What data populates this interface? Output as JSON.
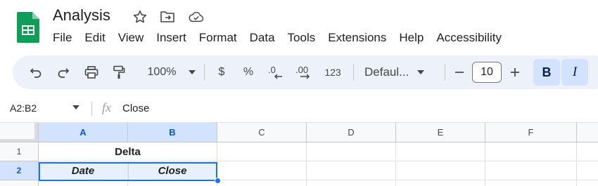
{
  "doc": {
    "title": "Analysis"
  },
  "menu": [
    "File",
    "Edit",
    "View",
    "Insert",
    "Format",
    "Data",
    "Tools",
    "Extensions",
    "Help",
    "Accessibility"
  ],
  "toolbar": {
    "zoom": "100%",
    "currency": "$",
    "percent": "%",
    "more_formats": "123",
    "font": "Defaul...",
    "font_size": "10",
    "bold": "B",
    "italic": "I",
    "icons": [
      "undo-icon",
      "redo-icon",
      "print-icon",
      "paint-format-icon",
      "decrease-decimal-icon",
      "increase-decimal-icon",
      "minus-icon",
      "plus-icon"
    ]
  },
  "formula_bar": {
    "name_box": "A2:B2",
    "fx": "fx",
    "value": "Close"
  },
  "grid": {
    "columns": [
      "A",
      "B",
      "C",
      "D",
      "E",
      "F"
    ],
    "rows": [
      "1",
      "2"
    ],
    "r1_merged": "Delta",
    "r2": [
      "Date",
      "Close"
    ]
  },
  "colors": {
    "accent": "#1a73e8",
    "selection_header": "#d3e3fd",
    "toolbar_bg": "#edf2fa",
    "logo_green": "#0f9d58"
  }
}
